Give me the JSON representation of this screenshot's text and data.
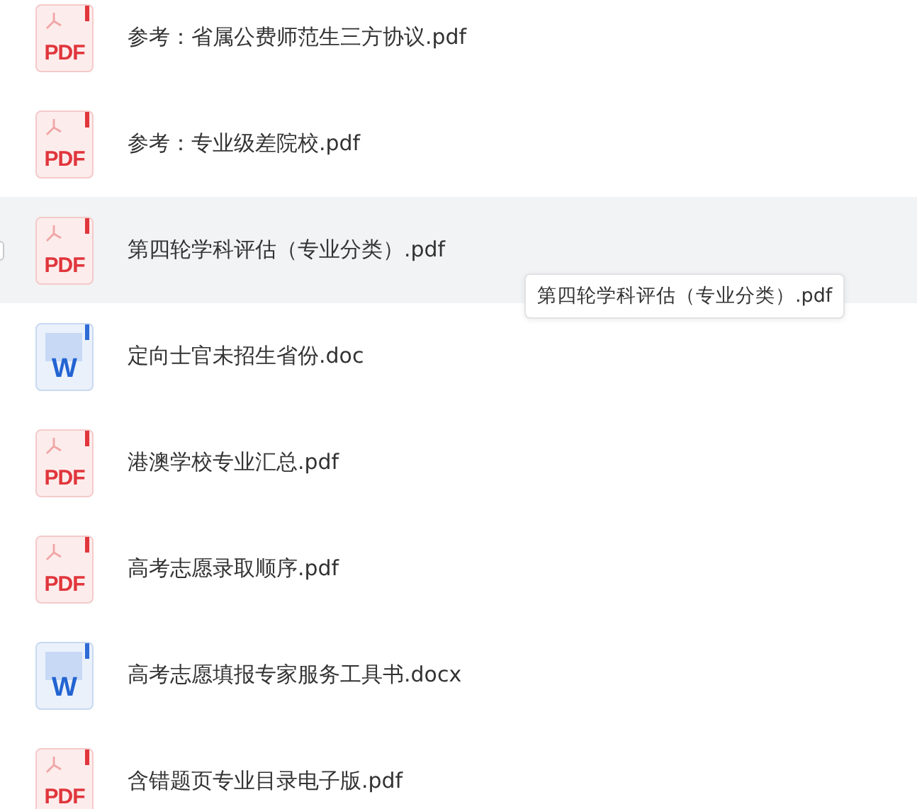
{
  "files": [
    {
      "kind": "pdf",
      "icon_label": "PDF",
      "name": "参考：省属公费师范生三方协议.pdf",
      "hovered": false
    },
    {
      "kind": "pdf",
      "icon_label": "PDF",
      "name": "参考：专业级差院校.pdf",
      "hovered": false
    },
    {
      "kind": "pdf",
      "icon_label": "PDF",
      "name": "第四轮学科评估（专业分类）.pdf",
      "hovered": true
    },
    {
      "kind": "word",
      "icon_label": "W",
      "name": "定向士官未招生省份.doc",
      "hovered": false
    },
    {
      "kind": "pdf",
      "icon_label": "PDF",
      "name": "港澳学校专业汇总.pdf",
      "hovered": false
    },
    {
      "kind": "pdf",
      "icon_label": "PDF",
      "name": "高考志愿录取顺序.pdf",
      "hovered": false
    },
    {
      "kind": "word",
      "icon_label": "W",
      "name": "高考志愿填报专家服务工具书.docx",
      "hovered": false
    },
    {
      "kind": "pdf",
      "icon_label": "PDF",
      "name": "含错题页专业目录电子版.pdf",
      "hovered": false
    }
  ],
  "tooltip": {
    "text": "第四轮学科评估（专业分类）.pdf"
  }
}
